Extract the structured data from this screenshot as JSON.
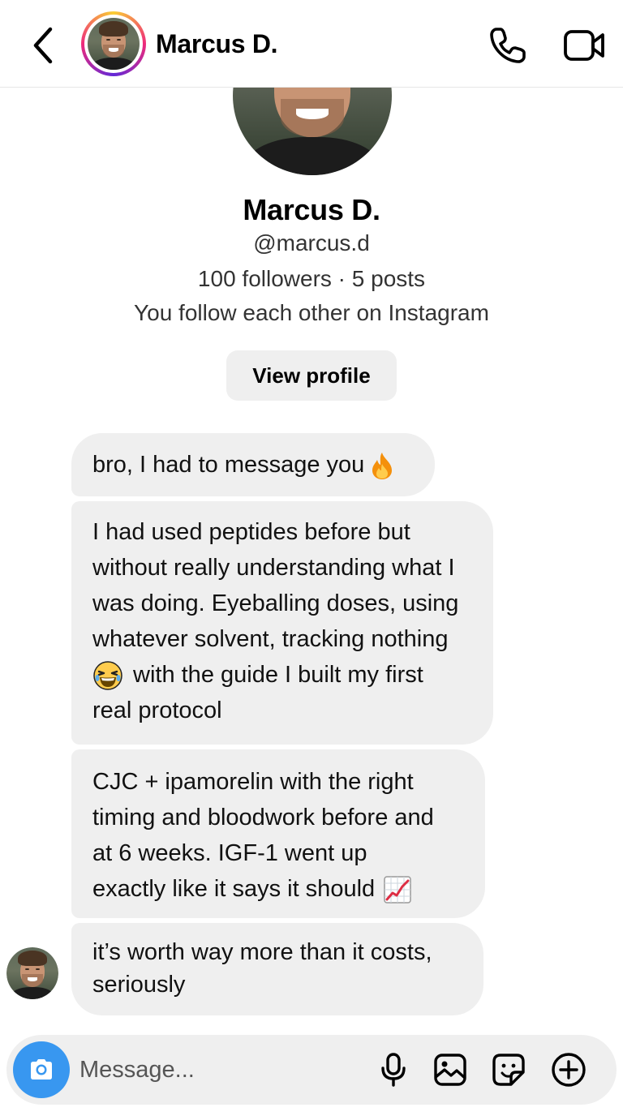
{
  "header": {
    "back_icon": "chevron-left-icon",
    "title": "Marcus D.",
    "call_icon": "phone-icon",
    "video_icon": "video-camera-icon",
    "avatar_ring_colors": [
      "#f9ce34",
      "#ee2a7b",
      "#6228d7"
    ]
  },
  "profile": {
    "name": "Marcus D.",
    "handle": "@marcus.d",
    "stats": "100 followers · 5 posts",
    "mutual": "You follow each other on Instagram",
    "view_profile_label": "View profile"
  },
  "messages": [
    {
      "lines": [
        "bro, I had to message you"
      ],
      "emoji": "fire-emoji"
    },
    {
      "lines": [
        "I had used peptides before but",
        "without really understanding what I",
        "was doing. Eyeballing doses, using",
        "whatever solvent, tracking nothing",
        "with the guide I built my first",
        "real protocol"
      ],
      "emoji": "laughing-emoji"
    },
    {
      "lines": [
        "CJC + ipamorelin with the right",
        "timing and bloodwork before and",
        "at 6 weeks. IGF-1 went up",
        "exactly like it says it should"
      ],
      "emoji": "chart-increasing-emoji"
    },
    {
      "lines": [
        "it’s worth way more than it costs,",
        "seriously"
      ]
    }
  ],
  "composer": {
    "placeholder": "Message...",
    "value": "",
    "camera_icon": "camera-icon",
    "mic_icon": "microphone-icon",
    "gallery_icon": "image-icon",
    "sticker_icon": "sticker-icon",
    "plus_icon": "plus-circle-icon",
    "accent_color": "#3897f0"
  }
}
